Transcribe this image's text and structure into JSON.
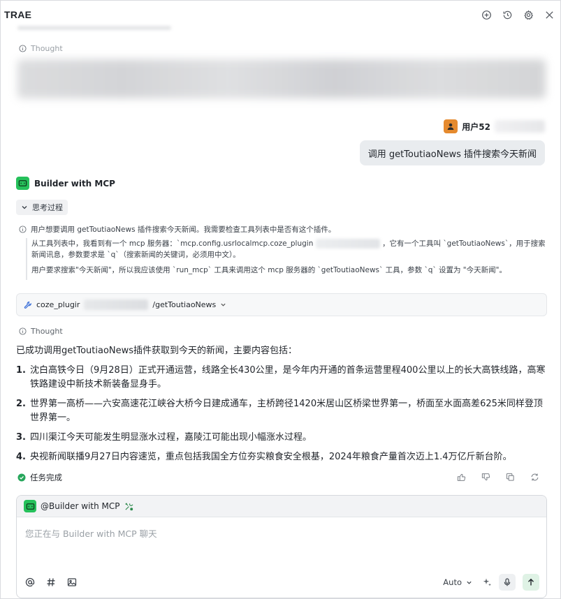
{
  "app": {
    "title": "TRAE"
  },
  "titlebar": {
    "icons": [
      "new-chat-icon",
      "history-icon",
      "settings-icon",
      "close-icon"
    ]
  },
  "history": {
    "thought_label": "Thought"
  },
  "user": {
    "name_prefix": "用户52",
    "message": "调用 getToutiaoNews 插件搜索今天新闻",
    "avatar_color": "#e58a2e"
  },
  "bot": {
    "name": "Builder with MCP",
    "brand_color": "#26c15b",
    "think_toggle": "思考过程",
    "reasoning": {
      "intro": "用户想要调用 getToutiaoNews 插件搜索今天新闻。我需要检查工具列表中是否有这个插件。",
      "p1_a": "从工具列表中，我看到有一个 mcp 服务器：`mcp.config.usrlocalmcp.coze_plugin",
      "p1_b": "，它有一个工具叫 `getToutiaoNews`，用于搜索新闻讯息，参数要求是 `q`（搜索新闻的关键词，必须用中文）。",
      "p2": "用户要求搜索\"今天新闻\"，所以我应该使用 `run_mcp` 工具来调用这个 mcp 服务器的 `getToutiaoNews` 工具，参数 `q` 设置为 \"今天新闻\"。"
    },
    "tool_call": {
      "prefix": "coze_plugir",
      "suffix": "/getToutiaoNews"
    },
    "thought_label": "Thought",
    "answer": {
      "lead": "已成功调用getToutiaoNews插件获取到今天的新闻，主要内容包括：",
      "items": [
        {
          "num": "1.",
          "text": "沈白高铁今日（9月28日）正式开通运营，线路全长430公里，是今年内开通的首条运营里程400公里以上的长大高铁线路，高寒铁路建设中新技术新装备显身手。"
        },
        {
          "num": "2.",
          "text": "世界第一高桥——六安高速花江峡谷大桥今日建成通车，主桥跨径1420米居山区桥梁世界第一，桥面至水面高差625米同样登顶世界第一。"
        },
        {
          "num": "3.",
          "text": "四川渠江今天可能发生明显涨水过程，嘉陵江可能出现小幅涨水过程。"
        },
        {
          "num": "4.",
          "text": "央视新闻联播9月27日内容速览，重点包括我国全方位夯实粮食安全根基，2024年粮食产量首次迈上1.4万亿斤新台阶。"
        }
      ]
    },
    "status": "任务完成",
    "status_color": "#26a65b",
    "feedback_icons": [
      "thumbs-up-icon",
      "thumbs-down-icon",
      "copy-icon",
      "regenerate-icon"
    ]
  },
  "composer": {
    "agent_mention": "@Builder with MCP",
    "placeholder": "您正在与 Builder with MCP 聊天",
    "mode": "Auto",
    "tools": [
      "at-mention-icon",
      "hashtag-icon",
      "image-icon"
    ]
  }
}
